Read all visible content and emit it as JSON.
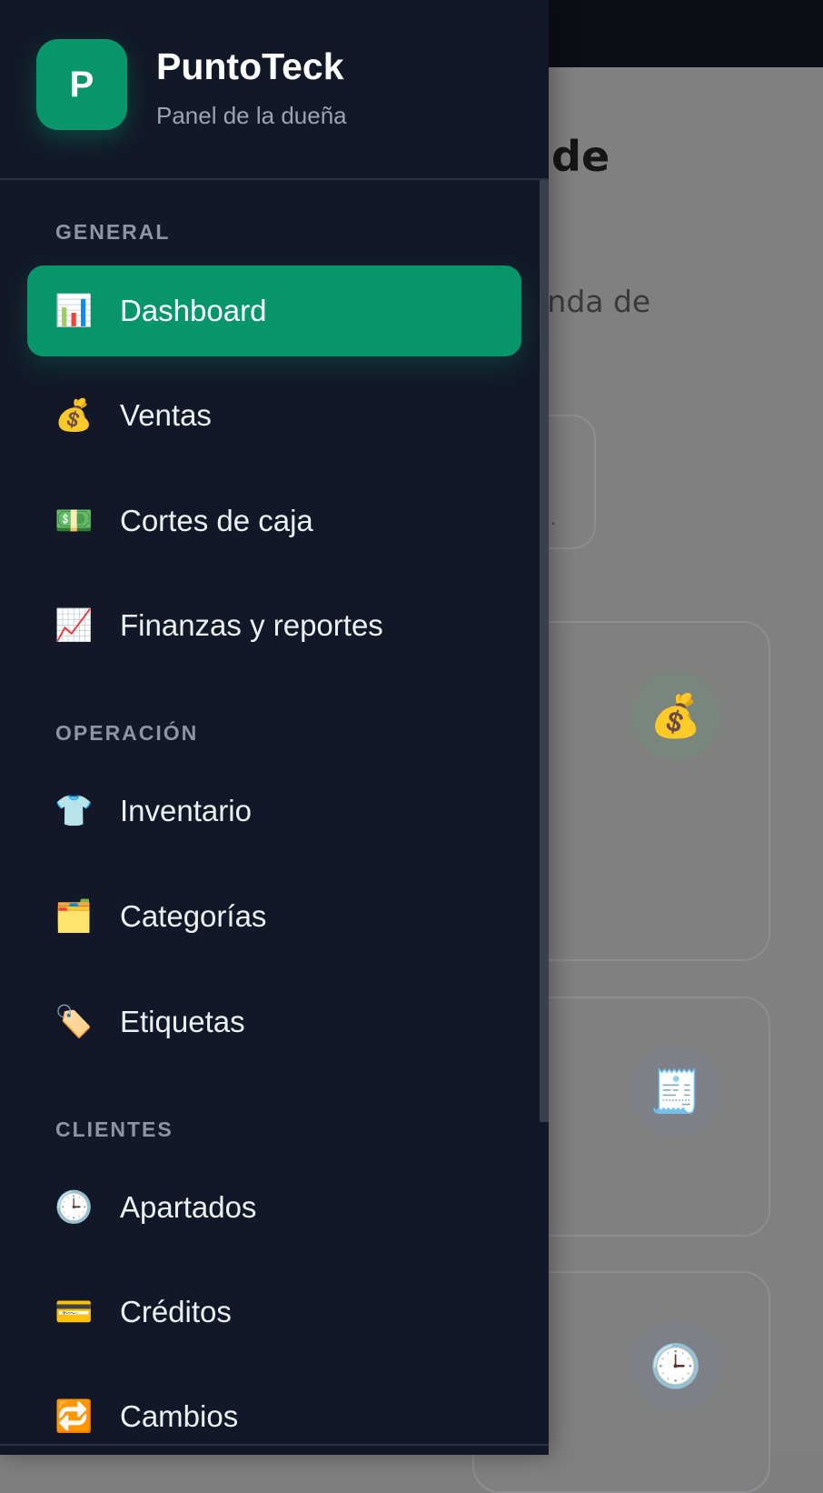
{
  "background": {
    "title_fragment": "a de",
    "subtitle_fragment": "tienda de",
    "search_fragment": ".",
    "cards": [
      {
        "icon": "money-bag-icon",
        "glyph": "💰"
      },
      {
        "icon": "receipt-icon",
        "glyph": "🧾"
      },
      {
        "icon": "clock-icon",
        "glyph": "🕒"
      }
    ]
  },
  "drawer": {
    "brand_initial": "P",
    "app_name": "PuntoTeck",
    "subtitle": "Panel de la dueña",
    "sections": {
      "general": "GENERAL",
      "operacion": "OPERACIÓN",
      "clientes": "CLIENTES"
    },
    "items": [
      {
        "label": "Dashboard",
        "icon": "bar-chart-icon",
        "glyph": "📊",
        "active": true
      },
      {
        "label": "Ventas",
        "icon": "money-bag-icon",
        "glyph": "💰"
      },
      {
        "label": "Cortes de caja",
        "icon": "dollar-banknote-icon",
        "glyph": "💵"
      },
      {
        "label": "Finanzas y reportes",
        "icon": "chart-increasing-icon",
        "glyph": "📈"
      },
      {
        "label": "Inventario",
        "icon": "t-shirt-icon",
        "glyph": "👕"
      },
      {
        "label": "Categorías",
        "icon": "folder-icon",
        "glyph": "🗂️"
      },
      {
        "label": "Etiquetas",
        "icon": "label-tag-icon",
        "glyph": "🏷️"
      },
      {
        "label": "Apartados",
        "icon": "clock-icon",
        "glyph": "🕒"
      },
      {
        "label": "Créditos",
        "icon": "credit-card-icon",
        "glyph": "💳"
      },
      {
        "label": "Cambios",
        "icon": "repeat-icon",
        "glyph": "🔁"
      }
    ]
  },
  "colors": {
    "drawer_bg": "#121827",
    "accent": "#079669",
    "section_text": "#8d94a3"
  }
}
